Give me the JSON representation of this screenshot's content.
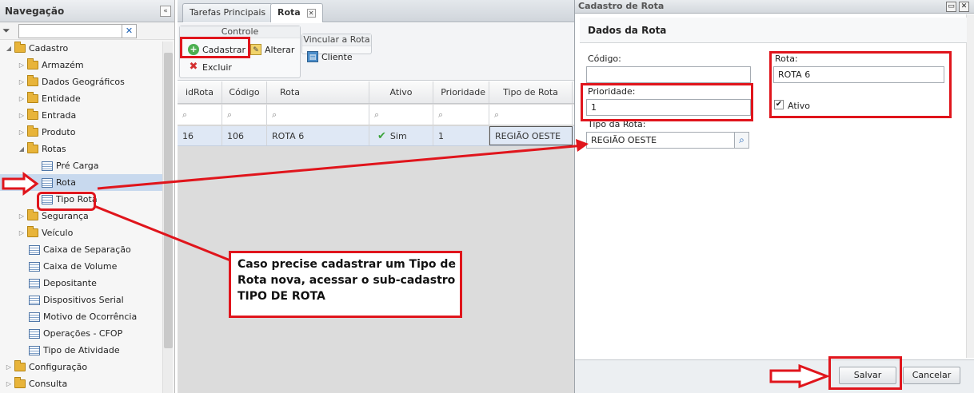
{
  "nav": {
    "title": "Navegação",
    "filter_value": "",
    "items": [
      {
        "label": "Cadastro",
        "kind": "folder",
        "arrow": "open"
      },
      {
        "label": "Armazém",
        "kind": "folder",
        "arrow": "closed"
      },
      {
        "label": "Dados Geográficos",
        "kind": "folder",
        "arrow": "closed"
      },
      {
        "label": "Entidade",
        "kind": "folder",
        "arrow": "closed"
      },
      {
        "label": "Entrada",
        "kind": "folder",
        "arrow": "closed"
      },
      {
        "label": "Produto",
        "kind": "folder",
        "arrow": "closed"
      },
      {
        "label": "Rotas",
        "kind": "folder",
        "arrow": "open"
      },
      {
        "label": "Pré Carga",
        "kind": "leaf"
      },
      {
        "label": "Rota",
        "kind": "leaf",
        "selected": true
      },
      {
        "label": "Tipo Rota",
        "kind": "leaf"
      },
      {
        "label": "Segurança",
        "kind": "folder",
        "arrow": "closed"
      },
      {
        "label": "Veículo",
        "kind": "folder",
        "arrow": "closed"
      },
      {
        "label": "Caixa de Separação",
        "kind": "leaf"
      },
      {
        "label": "Caixa de Volume",
        "kind": "leaf"
      },
      {
        "label": "Depositante",
        "kind": "leaf"
      },
      {
        "label": "Dispositivos Serial",
        "kind": "leaf"
      },
      {
        "label": "Motivo de Ocorrência",
        "kind": "leaf"
      },
      {
        "label": "Operações - CFOP",
        "kind": "leaf"
      },
      {
        "label": "Tipo de Atividade",
        "kind": "leaf"
      },
      {
        "label": "Configuração",
        "kind": "folder",
        "arrow": "closed"
      },
      {
        "label": "Consulta",
        "kind": "folder",
        "arrow": "closed"
      }
    ]
  },
  "tabs": [
    {
      "label": "Tarefas Principais",
      "active": false
    },
    {
      "label": "Rota",
      "active": true
    }
  ],
  "toolbar": {
    "group_controle": "Controle",
    "cadastrar": "Cadastrar",
    "alterar": "Alterar",
    "excluir": "Excluir",
    "group_vincular": "Vincular a Rota",
    "cliente": "Cliente"
  },
  "grid": {
    "columns": [
      "idRota",
      "Código",
      "Rota",
      "Ativo",
      "Prioridade",
      "Tipo de Rota"
    ],
    "rows": [
      {
        "idRota": "16",
        "codigo": "106",
        "rota": "ROTA 6",
        "ativo": "Sim",
        "prioridade": "1",
        "tipo": "REGIÃO OESTE"
      }
    ]
  },
  "dialog": {
    "title": "Cadastro de Rota",
    "section": "Dados da Rota",
    "codigo_label": "Código:",
    "codigo_value": "",
    "rota_label": "Rota:",
    "rota_value": "ROTA 6",
    "prioridade_label": "Prioridade:",
    "prioridade_value": "1",
    "ativo_label": "Ativo",
    "ativo_checked": true,
    "tipo_label": "Tipo da Rota:",
    "tipo_value": "REGIÃO OESTE",
    "salvar": "Salvar",
    "cancelar": "Cancelar"
  },
  "annotation": {
    "note_line1": "Caso precise cadastrar um Tipo de",
    "note_line2": "Rota nova, acessar o sub-cadastro",
    "note_line3": "TIPO DE ROTA",
    "color": "#e0151c"
  }
}
